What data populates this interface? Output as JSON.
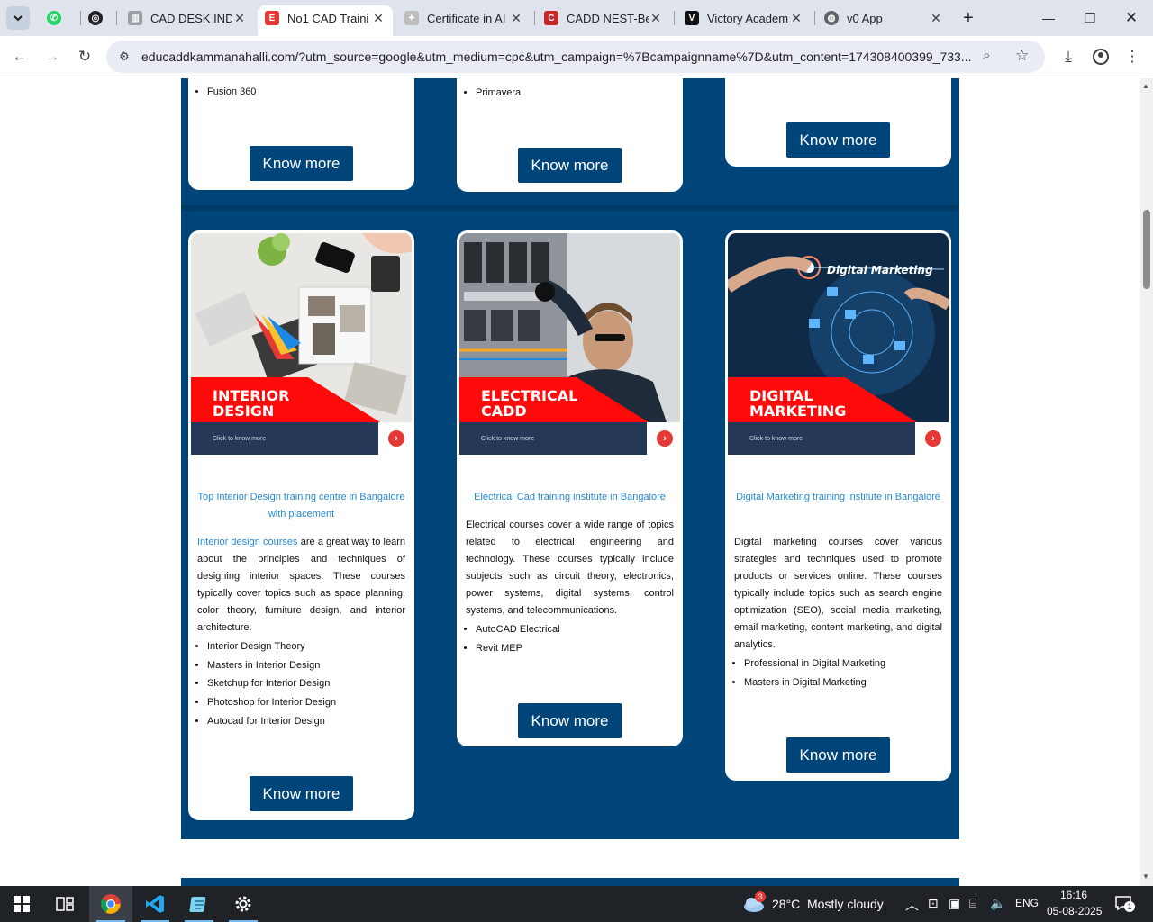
{
  "browser": {
    "tabs": [
      {
        "title": "",
        "icon": "whatsapp-icon",
        "color": "#25d366"
      },
      {
        "title": "",
        "icon": "openai-icon",
        "color": "#202124"
      },
      {
        "title": "CAD DESK INDI",
        "icon": "cad-desk-icon",
        "color": "#5f6368"
      },
      {
        "title": "No1 CAD Traini",
        "icon": "educadd-icon",
        "color": "#e53935",
        "active": true
      },
      {
        "title": "Certificate in AI",
        "icon": "certificate-icon",
        "color": "#9e9e9e"
      },
      {
        "title": "CADD NEST-Be",
        "icon": "caddnest-icon",
        "color": "#c62828"
      },
      {
        "title": "Victory Academ",
        "icon": "victory-icon",
        "color": "#111111"
      },
      {
        "title": "v0 App",
        "icon": "globe-icon",
        "color": "#5f6368"
      }
    ],
    "url": "educaddkammanahalli.com/?utm_source=google&utm_medium=cpc&utm_campaign=%7Bcampaignname%7D&utm_content=174308400399_733..."
  },
  "top_cards": [
    {
      "last_item": "Fusion 360",
      "button": "Know more"
    },
    {
      "last_item": "Primavera",
      "button": "Know more"
    },
    {
      "button": "Know more"
    }
  ],
  "cards": [
    {
      "banner_title_1": "INTERIOR",
      "banner_title_2": "DESIGN",
      "banner_cta": "Click to know more",
      "heading": "Top Interior Design training centre in Bangalore with placement",
      "desc_link": "Interior design courses",
      "desc": " are a great way to learn about the principles and techniques of designing interior spaces. These courses typically cover topics such as space planning, color theory, furniture design, and interior architecture.",
      "items": [
        "Interior Design Theory",
        "Masters in Interior Design",
        "Sketchup for Interior Design",
        "Photoshop for Interior Design",
        "Autocad for Interior Design"
      ],
      "button": "Know more"
    },
    {
      "banner_title_1": "ELECTRICAL",
      "banner_title_2": "CADD",
      "banner_cta": "Click to know more",
      "heading": "Electrical Cad training institute in Bangalore",
      "desc": "Electrical courses cover a wide range of topics related to electrical engineering and technology. These courses typically include subjects such as circuit theory, electronics, power systems, digital systems, control systems, and telecommunications.",
      "items": [
        "AutoCAD Electrical",
        "Revit MEP"
      ],
      "button": "Know more"
    },
    {
      "banner_title_1": "DIGITAL",
      "banner_title_2": "MARKETING",
      "banner_cta": "Click to know more",
      "banner_overlay": "Digital Marketing",
      "heading": "Digital Marketing training institute in Bangalore",
      "desc": "Digital marketing courses cover various strategies and techniques used to promote products or services online. These courses typically include topics such as search engine optimization (SEO), social media marketing, email marketing, content marketing, and digital analytics.",
      "items": [
        "Professional in Digital Marketing",
        "Masters in Digital Marketing"
      ],
      "button": "Know more"
    }
  ],
  "taskbar": {
    "weather_temp": "28°C",
    "weather_text": "Mostly cloudy",
    "weather_badge": "3",
    "language": "ENG",
    "time": "16:16",
    "date": "05-08-2025",
    "notification_count": "1"
  },
  "colors": {
    "brand_blue": "#00457a",
    "link_blue": "#2a8ad0",
    "accent_red": "#e53935"
  }
}
